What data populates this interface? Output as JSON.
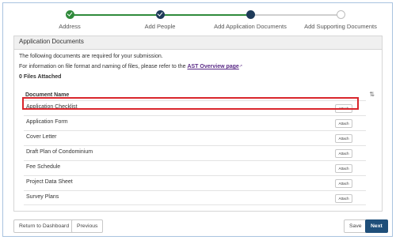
{
  "stepper": {
    "steps": [
      {
        "label": "Address",
        "state": "complete"
      },
      {
        "label": "Add People",
        "state": "complete"
      },
      {
        "label": "Add Application Documents",
        "state": "current"
      },
      {
        "label": "Add Supporting Documents",
        "state": "upcoming"
      }
    ],
    "colors": {
      "complete": "#2f8a3b",
      "current": "#1f3b59",
      "upcoming": "#bdbdbd"
    }
  },
  "panel": {
    "title": "Application Documents",
    "intro": "The following documents are required for your submission.",
    "info_prefix": "For information on file format and naming of files, please refer to the ",
    "info_link": "AST Overview page",
    "files_attached": "0 Files Attached",
    "column_header": "Document Name",
    "rows": [
      {
        "name": "Application Checklist",
        "action": "Attach"
      },
      {
        "name": "Application Form",
        "action": "Attach"
      },
      {
        "name": "Cover Letter",
        "action": "Attach"
      },
      {
        "name": "Draft Plan of Condominium",
        "action": "Attach"
      },
      {
        "name": "Fee Schedule",
        "action": "Attach"
      },
      {
        "name": "Project Data Sheet",
        "action": "Attach"
      },
      {
        "name": "Survey Plans",
        "action": "Attach"
      }
    ]
  },
  "footer": {
    "return_label": "Return to Dashboard",
    "previous_label": "Previous",
    "save_label": "Save",
    "next_label": "Next"
  },
  "highlight_color": "#d9262c"
}
